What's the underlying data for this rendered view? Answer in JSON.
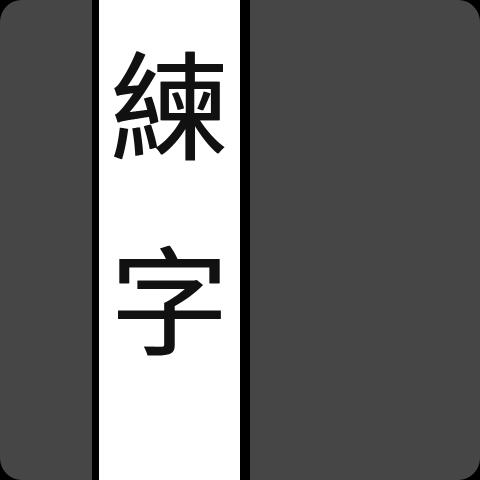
{
  "icon": {
    "background_color": "#464646",
    "strip_color": "#ffffff",
    "strip_border_color": "#000000",
    "text_color": "#111111"
  },
  "title": {
    "char_1": "練",
    "char_2": "字"
  }
}
